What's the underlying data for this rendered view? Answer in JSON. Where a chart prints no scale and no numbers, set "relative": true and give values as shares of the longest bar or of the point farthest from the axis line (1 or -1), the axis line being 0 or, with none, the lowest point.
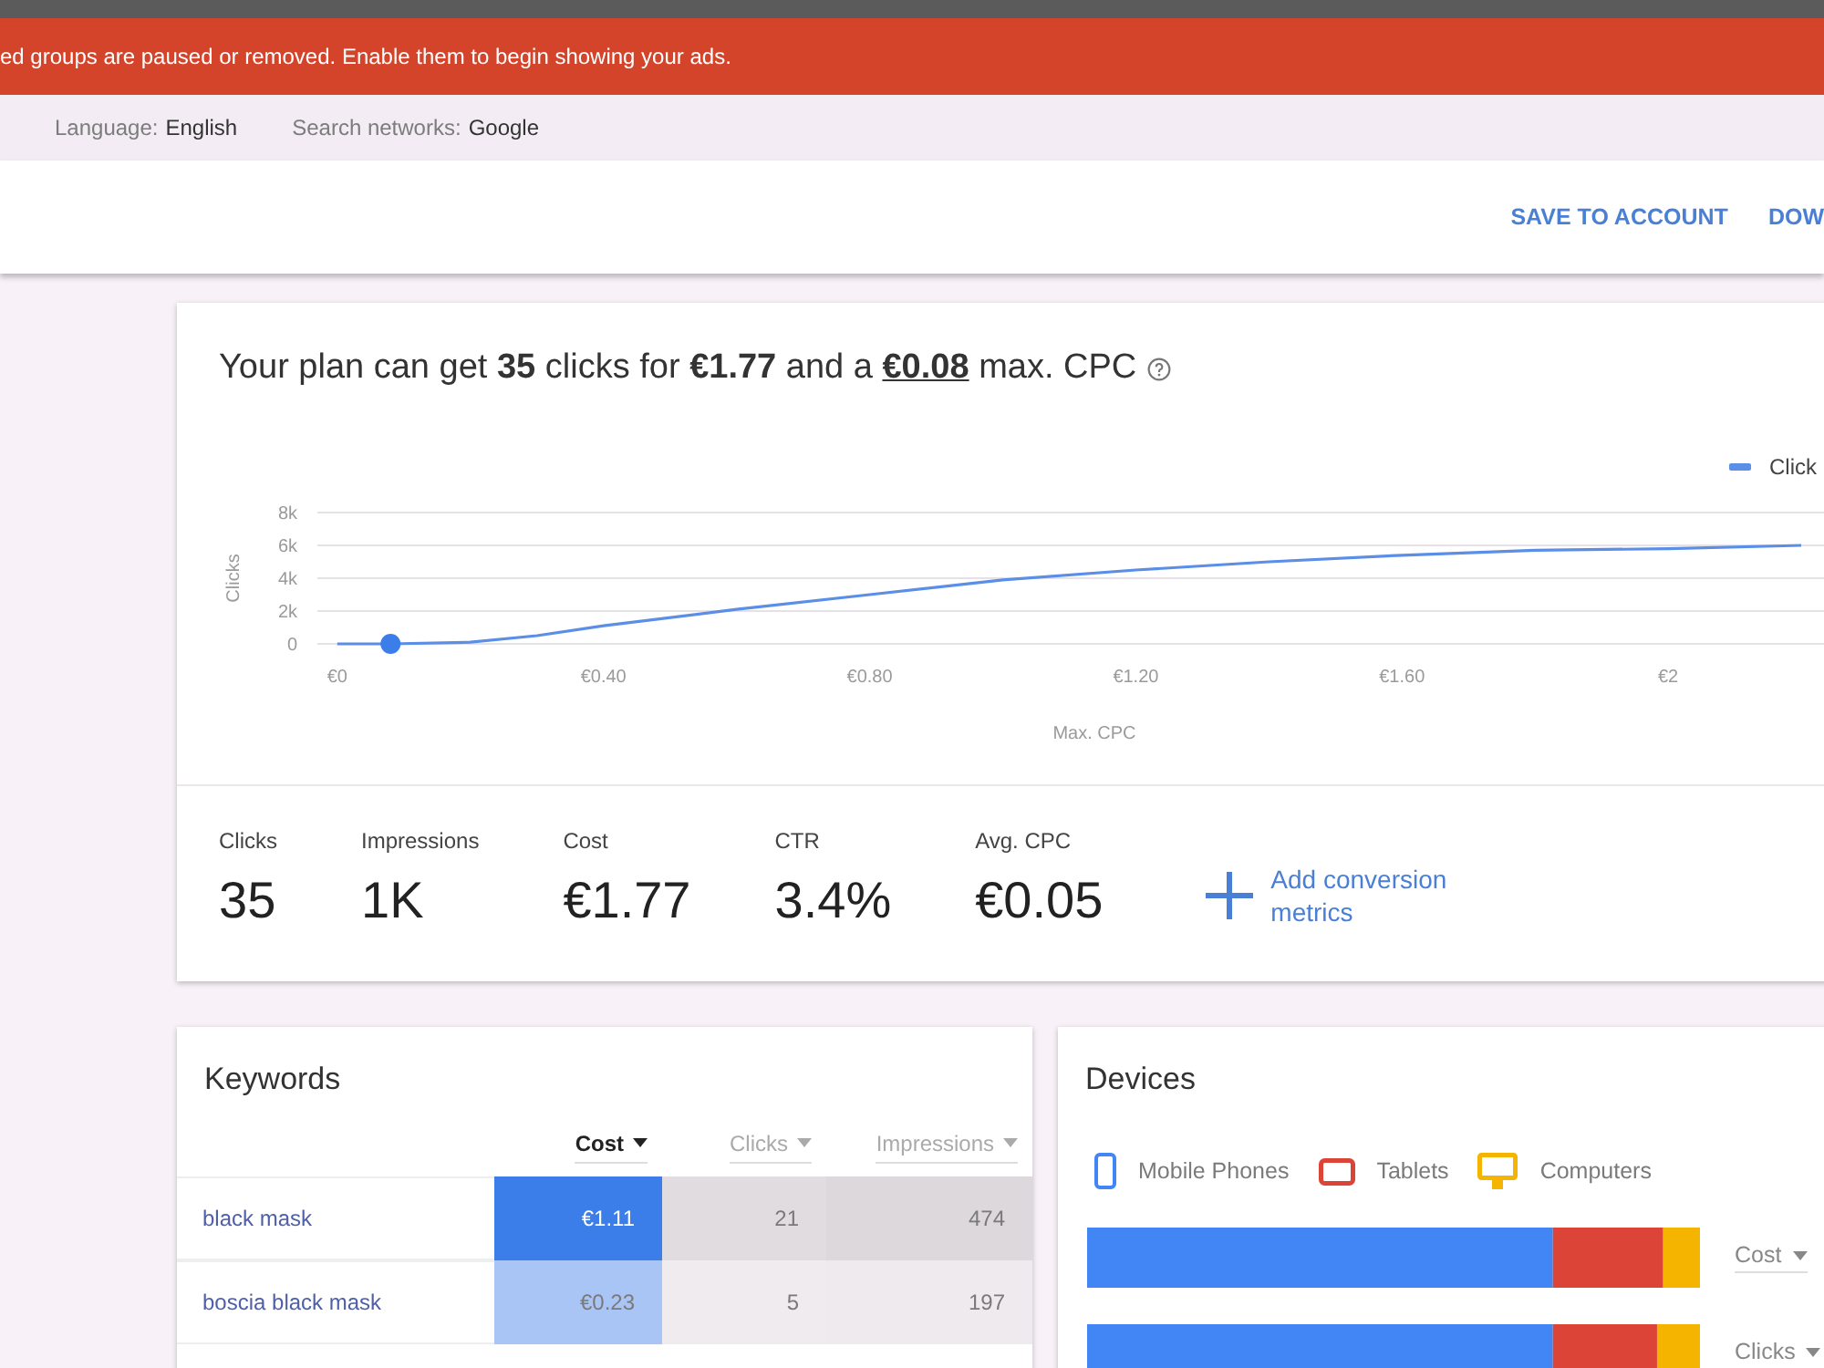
{
  "top_banner": {
    "message": "ed groups are paused or removed. Enable them to begin showing your ads."
  },
  "filters": [
    {
      "label": "Language:",
      "value": "English"
    },
    {
      "label": "Search networks:",
      "value": "Google"
    }
  ],
  "toolbar": {
    "actions": [
      "SAVE TO ACCOUNT",
      "DOW"
    ]
  },
  "forecast": {
    "summary_start": "Your plan can get **35** clicks for **€1.77** and a",
    "bid_link": "€0.08",
    "summary_end": "max. CPC",
    "chart_data": {
      "type": "line",
      "xlabel": "Max. CPC",
      "ylabel": "Clicks",
      "x": [
        0,
        0.08,
        0.2,
        0.3,
        0.4,
        0.6,
        0.8,
        1.0,
        1.2,
        1.4,
        1.6,
        1.8,
        2.0,
        2.2
      ],
      "series": [
        {
          "name": "Click",
          "color": "#5b8ee6",
          "values": [
            0,
            0,
            100,
            500,
            1100,
            2100,
            3000,
            3900,
            4500,
            5000,
            5400,
            5700,
            5800,
            6000
          ]
        },
        {
          "color": "#3b7de9",
          "marker": true,
          "values": [
            null,
            0,
            null,
            null,
            null,
            null,
            null,
            null,
            null,
            null,
            null,
            null,
            null,
            null
          ]
        }
      ],
      "xlim": [
        -0.03,
        2.3
      ],
      "ylim": [
        0,
        8000
      ],
      "grid": true,
      "xticks": [
        {
          "value": 0,
          "label": "€0"
        },
        {
          "value": 0.4,
          "label": "€0.40"
        },
        {
          "value": 0.8,
          "label": "€0.80"
        },
        {
          "value": 1.2,
          "label": "€1.20"
        },
        {
          "value": 1.6,
          "label": "€1.60"
        },
        {
          "value": 2,
          "label": "€2"
        }
      ],
      "yticks": [
        {
          "value": 0,
          "label": "0"
        },
        {
          "value": 2000,
          "label": "2k"
        },
        {
          "value": 4000,
          "label": "4k"
        },
        {
          "value": 6000,
          "label": "6k"
        },
        {
          "value": 8000,
          "label": "8k"
        }
      ]
    },
    "metrics": [
      {
        "label": "Clicks",
        "value": "35"
      },
      {
        "label": "Impressions",
        "value": "1K"
      },
      {
        "label": "Cost",
        "value": "€1.77"
      },
      {
        "label": "CTR",
        "value": "3.4%"
      },
      {
        "label": "Avg. CPC",
        "value": "€0.05"
      }
    ],
    "add_metrics": "Add conversion metrics"
  },
  "keywords": {
    "title": "Keywords",
    "columns": [
      {
        "label": "Cost",
        "selected": true
      },
      {
        "label": "Clicks",
        "selected": false
      },
      {
        "label": "Impressions",
        "selected": false
      }
    ],
    "rows": [
      {
        "keyword": "black mask",
        "cells": [
          {
            "value": "€1.11",
            "color": "#3b7de9"
          },
          {
            "value": "21",
            "color": "#e0dce0"
          },
          {
            "value": "474",
            "color": "#dcd8dc"
          }
        ]
      },
      {
        "keyword": "boscia black mask",
        "cells": [
          {
            "value": "€0.23",
            "color": "#a9c5f5"
          },
          {
            "value": "5",
            "color": "#efebef"
          },
          {
            "value": "197",
            "color": "#eeeaee"
          }
        ]
      }
    ]
  },
  "devices": {
    "title": "Devices",
    "legend_icons": [
      {
        "kind": "phone"
      },
      {
        "kind": "tablet"
      },
      {
        "kind": "computer"
      }
    ],
    "chart_data": {
      "type": "bar",
      "orientation": "horizontal",
      "stacked": true,
      "relative": true,
      "categories": [
        "Cost",
        "Clicks"
      ],
      "series": [
        {
          "name": "Mobile Phones",
          "color": "#4285f4",
          "values": [
            0.76,
            0.76
          ]
        },
        {
          "name": "Tablets",
          "color": "#db4437",
          "values": [
            0.18,
            0.17
          ]
        },
        {
          "name": "Computers",
          "color": "#f4b400",
          "values": [
            0.06,
            0.07
          ]
        }
      ]
    }
  }
}
